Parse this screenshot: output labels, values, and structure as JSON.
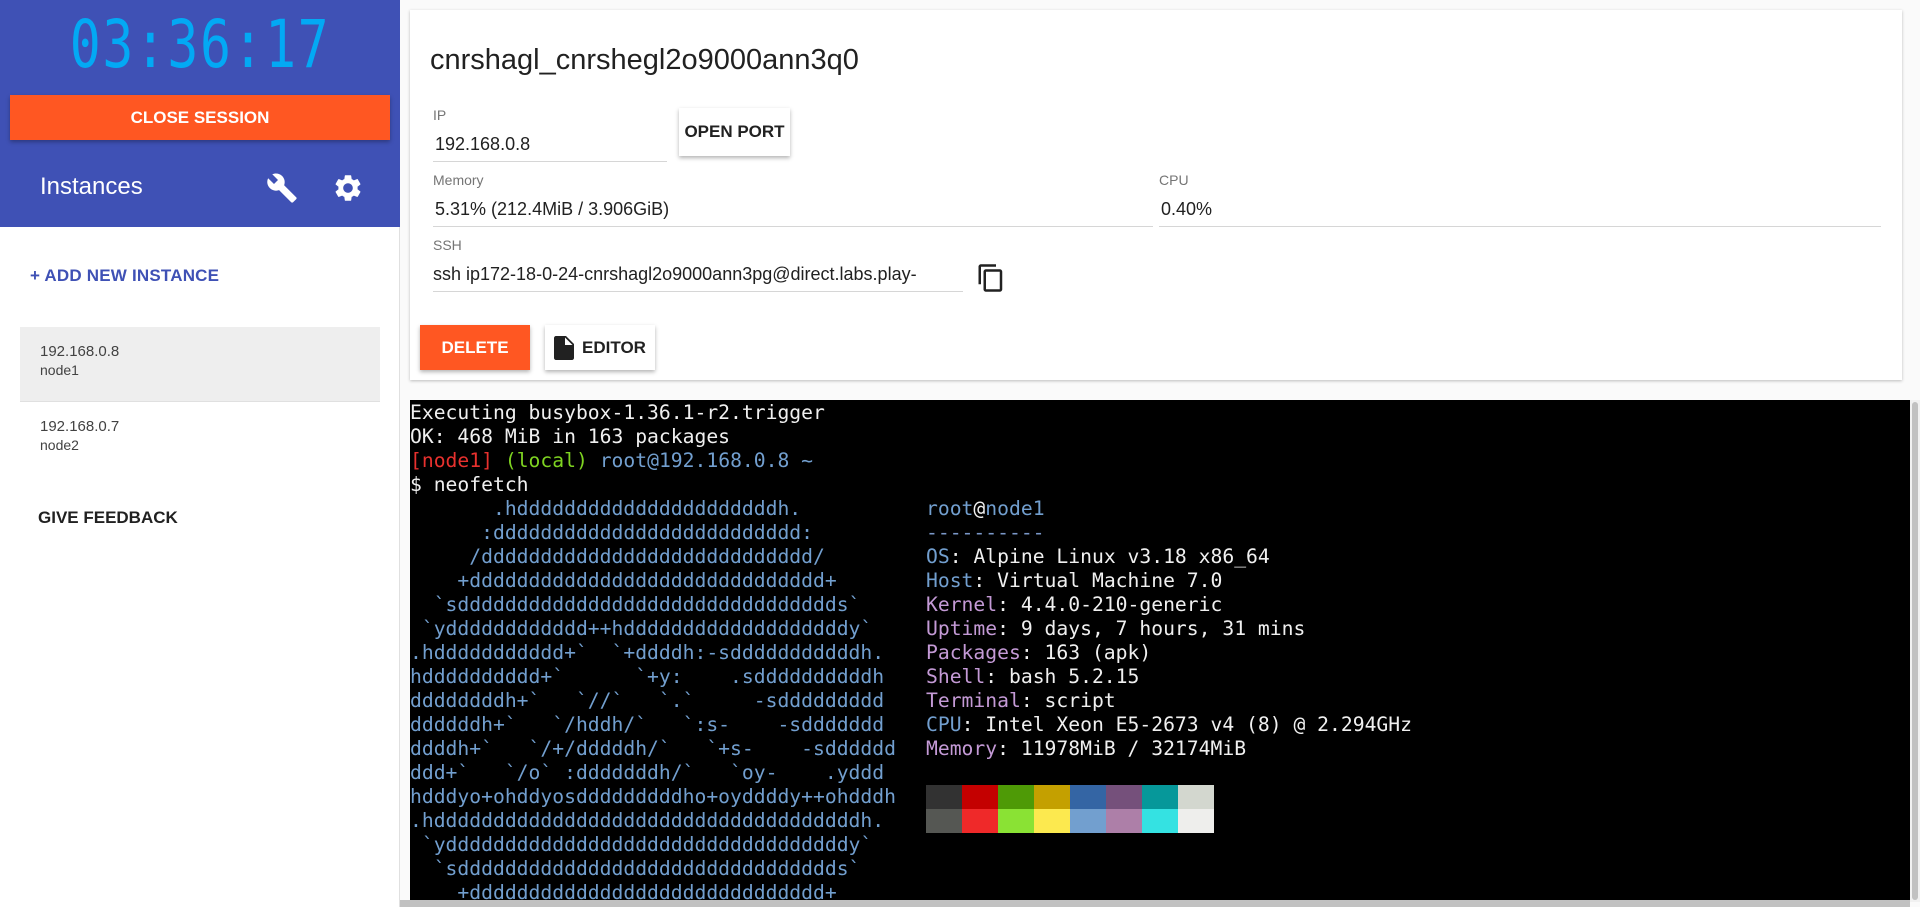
{
  "sidebar": {
    "clock": "03:36:17",
    "close_session_label": "CLOSE SESSION",
    "instances_title": "Instances",
    "add_instance_label": "+ ADD NEW INSTANCE",
    "instances": [
      {
        "ip": "192.168.0.8",
        "name": "node1",
        "active": true
      },
      {
        "ip": "192.168.0.7",
        "name": "node2",
        "active": false
      }
    ],
    "feedback_label": "GIVE FEEDBACK",
    "icons": [
      "wrench-icon",
      "gear-icon"
    ]
  },
  "details": {
    "session_name": "cnrshagl_cnrshegl2o9000ann3q0",
    "ip_label": "IP",
    "ip_value": "192.168.0.8",
    "open_port_label": "OPEN PORT",
    "memory_label": "Memory",
    "memory_value": "5.31% (212.4MiB / 3.906GiB)",
    "cpu_label": "CPU",
    "cpu_value": "0.40%",
    "ssh_label": "SSH",
    "ssh_value": "ssh ip172-18-0-24-cnrshagl2o9000ann3pg@direct.labs.play-",
    "delete_label": "DELETE",
    "editor_label": "EDITOR"
  },
  "terminal": {
    "line1": "Executing busybox-1.36.1-r2.trigger",
    "line2": "OK: 468 MiB in 163 packages",
    "prompt_node": "[node1]",
    "prompt_local": "(local)",
    "prompt_user": "root@192.168.0.8 ~",
    "prompt_cmd": "$ neofetch",
    "logo": [
      "       .hddddddddddddddddddddddh.",
      "      :dddddddddddddddddddddddddd:",
      "     /dddddddddddddddddddddddddddd/",
      "    +dddddddddddddddddddddddddddddd+",
      "  `sdddddddddddddddddddddddddddddddds`",
      " `ydddddddddddd++hdddddddddddddddddddy`",
      ".hddddddddddd+`  `+ddddh:-sdddddddddddh.",
      "hdddddddddd+`      `+y:    .sddddddddddh",
      "ddddddddh+`   `//`   `.`     -sddddddddd",
      "ddddddh+`   `/hddh/`   `:s-    -sddddddd",
      "ddddh+`   `/+/dddddh/`   `+s-    -sdddddd",
      "ddd+`   `/o` :dddddddh/`   `oy-    .yddd",
      "hdddyo+ohddyosdddddddddho+oyddddy++ohdddh",
      ".hddddddddddddddddddddddddddddddddddddh.",
      " `yddddddddddddddddddddddddddddddddddy`",
      "  `sdddddddddddddddddddddddddddddddds`",
      "    +dddddddddddddddddddddddddddddd+"
    ],
    "user": "root",
    "host": "node1",
    "separator": "----------",
    "info": [
      {
        "key": "OS",
        "value": "Alpine Linux v3.18 x86_64",
        "color": "blue"
      },
      {
        "key": "Host",
        "value": "Virtual Machine 7.0",
        "color": "blue"
      },
      {
        "key": "Kernel",
        "value": "4.4.0-210-generic",
        "color": "purple"
      },
      {
        "key": "Uptime",
        "value": "9 days, 7 hours, 31 mins",
        "color": "purple"
      },
      {
        "key": "Packages",
        "value": "163 (apk)",
        "color": "purple"
      },
      {
        "key": "Shell",
        "value": "bash 5.2.15",
        "color": "purple"
      },
      {
        "key": "Terminal",
        "value": "script",
        "color": "purple"
      },
      {
        "key": "CPU",
        "value": "Intel Xeon E5-2673 v4 (8) @ 2.294GHz",
        "color": "blue"
      },
      {
        "key": "Memory",
        "value": "11978MiB / 32174MiB",
        "color": "purple"
      }
    ],
    "palette_top": [
      "#323232",
      "#c40000",
      "#4e9a06",
      "#c4a000",
      "#3465a4",
      "#75507b",
      "#06989a",
      "#d3d7cf"
    ],
    "palette_bottom": [
      "#555753",
      "#ef2929",
      "#8ae234",
      "#fce94f",
      "#729fcf",
      "#ad7fa8",
      "#34e2e2",
      "#eeeeec"
    ]
  },
  "colors": {
    "sidebar_header": "#3f51b5",
    "accent_orange": "#ff5722",
    "clock": "#03a9f4"
  }
}
